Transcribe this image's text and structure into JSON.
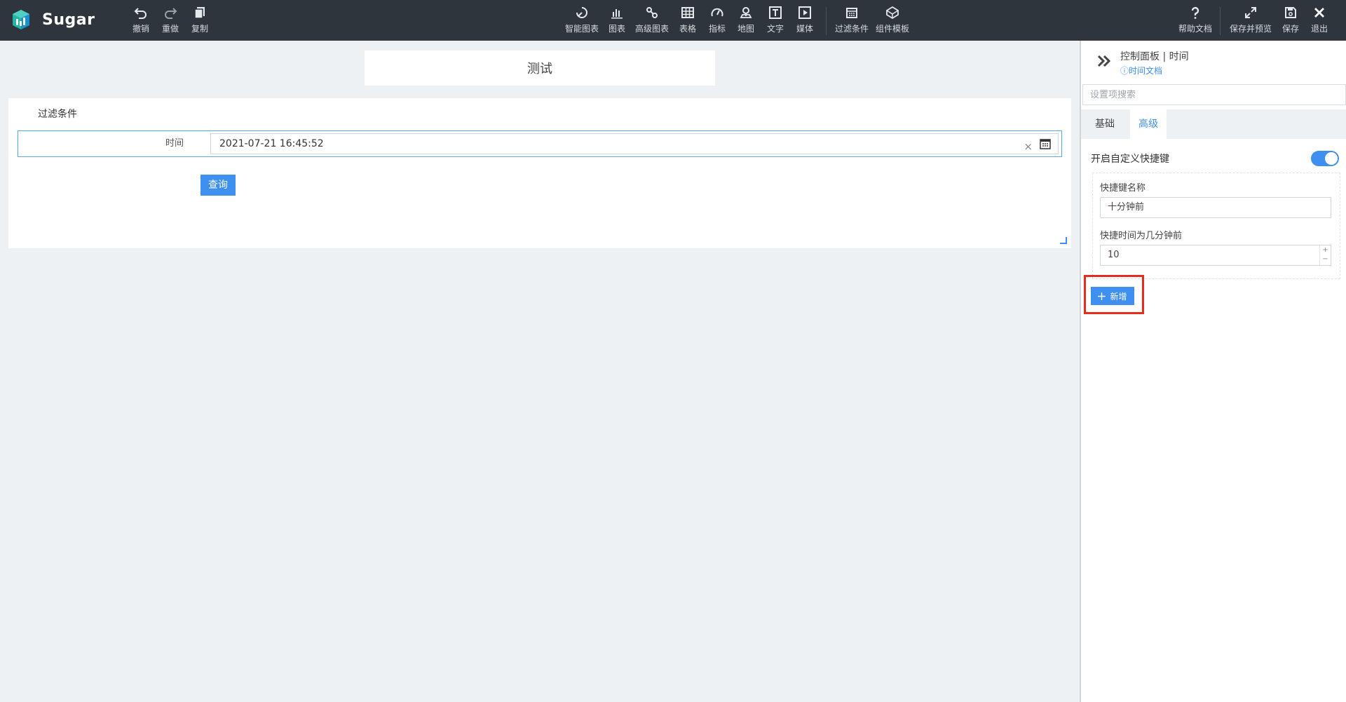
{
  "app": {
    "name": "Sugar"
  },
  "toolbar": {
    "undo": "撤销",
    "redo": "重做",
    "copy": "复制",
    "smart_chart": "智能图表",
    "chart": "图表",
    "advanced_chart": "高级图表",
    "table": "表格",
    "metric": "指标",
    "map": "地图",
    "text": "文字",
    "media": "媒体",
    "filter": "过滤条件",
    "component_template": "组件模板",
    "help_doc": "帮助文档",
    "save_preview": "保存并预览",
    "save": "保存",
    "exit": "退出"
  },
  "canvas": {
    "title": "测试",
    "filter_card": {
      "heading": "过滤条件",
      "time_label": "时间",
      "time_value": "2021-07-21 16:45:52",
      "clear_glyph": "×",
      "query_button": "查询"
    }
  },
  "panel": {
    "title": "控制面板 | 时间",
    "doc_link": "ⓘ时间文档",
    "search_placeholder": "设置项搜索",
    "tabs": [
      "基础",
      "高级"
    ],
    "active_tab": "高级",
    "toggle_label": "开启自定义快捷键",
    "toggle_on": true,
    "shortcut_name_label": "快捷键名称",
    "shortcut_name_value": "十分钟前",
    "shortcut_minutes_label": "快捷时间为几分钟前",
    "shortcut_minutes_value": "10",
    "add_button": "新增",
    "add_icon": "plus-icon"
  },
  "colors": {
    "topbar": "#2f353c",
    "accent": "#3e8fef",
    "highlight": "#e52d1d",
    "canvas_bg": "#eef1f3"
  }
}
